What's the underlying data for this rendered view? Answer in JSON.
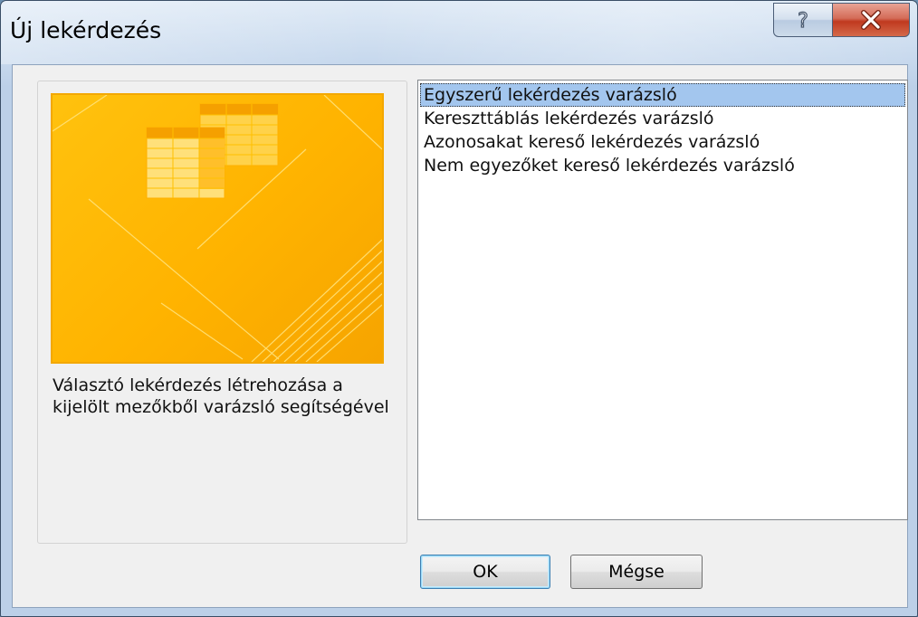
{
  "window": {
    "title": "Új lekérdezés"
  },
  "title_buttons": {
    "help_glyph": "?",
    "close_glyph": "✕",
    "help_icon": "help-icon",
    "close_icon": "close-icon"
  },
  "preview": {
    "icon": "query-wizard-table-icon",
    "description": "Választó lekérdezés létrehozása a kijelölt mezőkből varázsló segítségével"
  },
  "wizard_list": {
    "items": [
      "Egyszerű lekérdezés varázsló",
      "Kereszttáblás lekérdezés varázsló",
      "Azonosakat kereső lekérdezés varázsló",
      "Nem egyezőket kereső lekérdezés varázsló"
    ],
    "selected_index": 0
  },
  "buttons": {
    "ok_label": "OK",
    "cancel_label": "Mégse"
  },
  "colors": {
    "selection": "#a3c6ee",
    "preview_gold": "#ffb300",
    "close_red": "#c0391f"
  }
}
